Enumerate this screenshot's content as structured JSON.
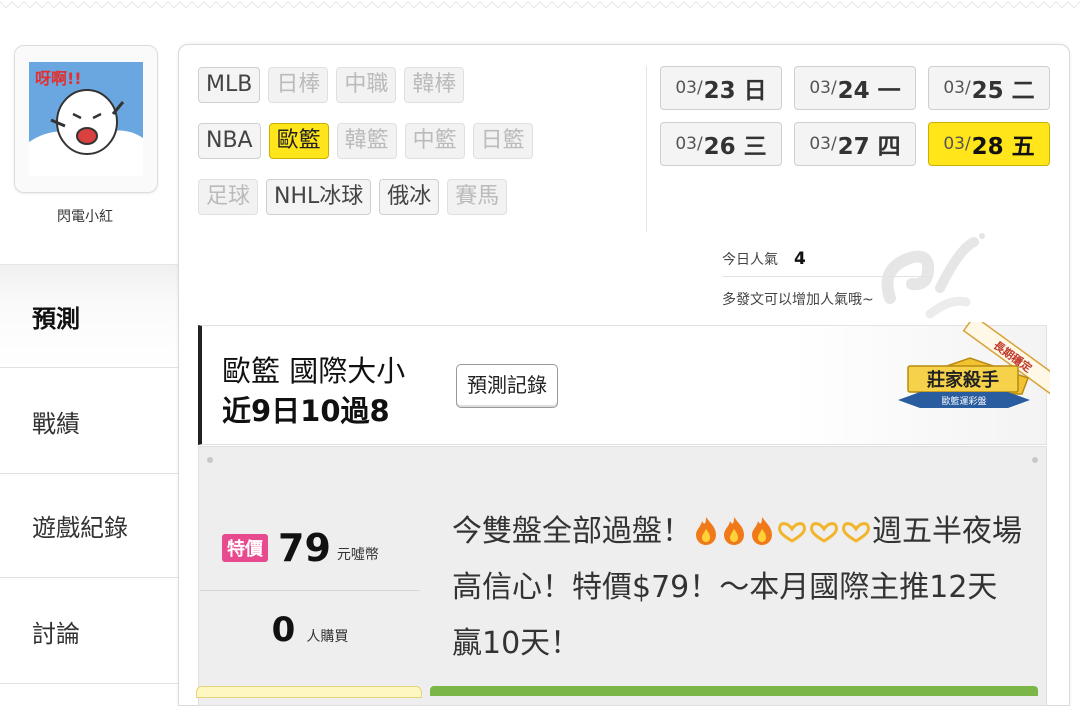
{
  "user": {
    "name": "閃電小紅",
    "avatar_text": "呀啊!!"
  },
  "sidebar": {
    "tabs": [
      {
        "label": "預測",
        "active": true
      },
      {
        "label": "戰績",
        "active": false
      },
      {
        "label": "遊戲紀錄",
        "active": false
      },
      {
        "label": "討論",
        "active": false
      }
    ]
  },
  "sports": {
    "rows": [
      [
        {
          "label": "MLB",
          "state": "normal"
        },
        {
          "label": "日棒",
          "state": "disabled"
        },
        {
          "label": "中職",
          "state": "disabled"
        },
        {
          "label": "韓棒",
          "state": "disabled"
        }
      ],
      [
        {
          "label": "NBA",
          "state": "normal"
        },
        {
          "label": "歐籃",
          "state": "selected"
        },
        {
          "label": "韓籃",
          "state": "disabled"
        },
        {
          "label": "中籃",
          "state": "disabled"
        },
        {
          "label": "日籃",
          "state": "disabled"
        }
      ],
      [
        {
          "label": "足球",
          "state": "disabled"
        },
        {
          "label": "NHL冰球",
          "state": "normal"
        },
        {
          "label": "俄冰",
          "state": "normal"
        },
        {
          "label": "賽馬",
          "state": "disabled"
        }
      ]
    ]
  },
  "dates": {
    "rows": [
      [
        {
          "md": "03/",
          "d": "23 日",
          "selected": false
        },
        {
          "md": "03/",
          "d": "24 一",
          "selected": false
        },
        {
          "md": "03/",
          "d": "25 二",
          "selected": false
        }
      ],
      [
        {
          "md": "03/",
          "d": "26 三",
          "selected": false
        },
        {
          "md": "03/",
          "d": "27 四",
          "selected": false
        },
        {
          "md": "03/",
          "d": "28 五",
          "selected": true
        }
      ]
    ]
  },
  "popularity": {
    "label": "今日人氣",
    "value": "4",
    "hint": "多發文可以增加人氣哦~"
  },
  "prediction": {
    "title": "歐籃 國際大小",
    "record": "近9日10過8",
    "record_button": "預測記錄",
    "badge": {
      "ribbon": "長期穩定",
      "title": "莊家殺手",
      "subtitle": "歐籃運彩盤"
    },
    "special_tag": "特價",
    "price": "79",
    "price_unit": "元噓幣",
    "buyers": "0",
    "buyers_unit": "人購買",
    "text_part1": "今雙盤全部過盤！",
    "text_part2": "週",
    "text_part3": "五半夜場高信心！特價$79！～本月國際主推12天贏10天！"
  },
  "colors": {
    "selected_yellow": "#ffe51a",
    "special_pink": "#e84a8f",
    "badge_gold": "#f2c230",
    "badge_blue": "#2a5d9f"
  }
}
